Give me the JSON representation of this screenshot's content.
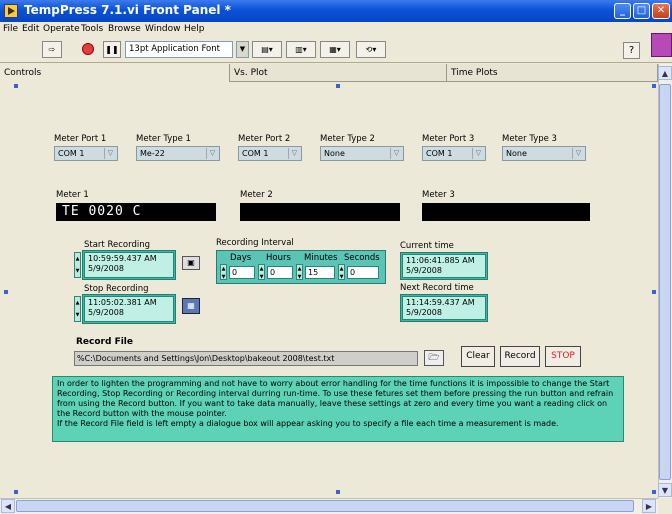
{
  "window": {
    "title": "TempPress 7.1.vi Front Panel *"
  },
  "menu": [
    "File",
    "Edit",
    "Operate",
    "Tools",
    "Browse",
    "Window",
    "Help"
  ],
  "toolbar": {
    "font": "13pt Application Font"
  },
  "tabs": [
    "Controls",
    "Vs. Plot",
    "Time Plots"
  ],
  "meters": [
    {
      "port_label": "Meter Port 1",
      "port": "COM 1",
      "type_label": "Meter Type 1",
      "type": "Me-22",
      "name": "Meter 1",
      "reading": "TE  0020    C"
    },
    {
      "port_label": "Meter Port 2",
      "port": "COM 1",
      "type_label": "Meter Type 2",
      "type": "None",
      "name": "Meter 2",
      "reading": ""
    },
    {
      "port_label": "Meter Port 3",
      "port": "COM 1",
      "type_label": "Meter Type 3",
      "type": "None",
      "name": "Meter 3",
      "reading": ""
    }
  ],
  "start": {
    "label": "Start Recording",
    "time": "10:59:59.437 AM",
    "date": "5/9/2008"
  },
  "stop": {
    "label": "Stop Recording",
    "time": "11:05:02.381 AM",
    "date": "5/9/2008"
  },
  "interval": {
    "label": "Recording Interval",
    "fields": [
      {
        "label": "Days",
        "value": "0"
      },
      {
        "label": "Hours",
        "value": "0"
      },
      {
        "label": "Minutes",
        "value": "15"
      },
      {
        "label": "Seconds",
        "value": "0"
      }
    ]
  },
  "current": {
    "label": "Current time",
    "time": "11:06:41.885 AM",
    "date": "5/9/2008"
  },
  "next": {
    "label": "Next Record time",
    "time": "11:14:59.437 AM",
    "date": "5/9/2008"
  },
  "record_file": {
    "label": "Record File",
    "path": "C:\\Documents and Settings\\Jon\\Desktop\\bakeout 2008\\test.txt",
    "path_prefix": "%"
  },
  "buttons": {
    "clear": "Clear",
    "record": "Record",
    "stop": "STOP"
  },
  "colors": {
    "stop_text": "#e02020",
    "teal": "#3bb8a8",
    "note": "#5cd2b6"
  },
  "note": [
    "In order to lighten the programming and not have to worry about error handling for the time functions it is impossible to change the Start Recording, Stop Recording or Recording interval durring run-time.  To use these fetures set them before pressing the run button and refrain from using the Record button.  If you want to take data manually, leave these settings at zero and every time you want a reading click on the Record button with the mouse pointer.",
    "If the Record File field is left empty a dialogue box will appear asking you to specify a file each time a measurement is made."
  ]
}
